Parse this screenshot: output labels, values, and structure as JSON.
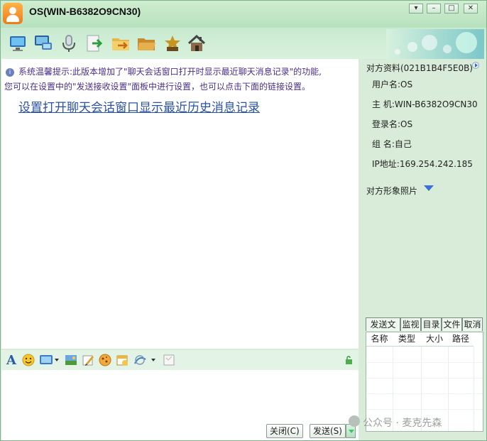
{
  "window": {
    "title": "OS(WIN-B6382O9CN30)"
  },
  "toolbar": {
    "icons": [
      "monitor-icon",
      "remote-desktop-icon",
      "microphone-icon",
      "send-file-icon",
      "send-folder-icon",
      "open-folder-icon",
      "puzzle-icon",
      "home-icon"
    ]
  },
  "notice": {
    "line1": "系统温馨提示:此版本增加了\"聊天会话窗口打开时显示最近聊天消息记录\"的功能,",
    "line2": "您可以在设置中的\"发送接收设置\"面板中进行设置，也可以点击下面的链接设置。",
    "link": "设置打开聊天会话窗口显示最近历史消息记录"
  },
  "side": {
    "header": "对方资料(021B1B4F5E0B)",
    "username": "用户名:OS",
    "host": "主  机:WIN-B6382O9CN30",
    "login": "登录名:OS",
    "group": "组  名:自己",
    "ip": "IP地址:169.254.242.185",
    "photo": "对方形象照片"
  },
  "tabs": [
    "发送文件",
    "监视",
    "目录",
    "文件",
    "取消"
  ],
  "file_columns": [
    "名称",
    "类型",
    "大小",
    "路径"
  ],
  "buttons": {
    "close": "关闭(C)",
    "send": "发送(S)"
  },
  "watermark": "公众号 · 麦克先森",
  "colors": {
    "notice_text": "#4a2f8a",
    "link": "#2a52a8",
    "frame": "#d9ecd9"
  }
}
